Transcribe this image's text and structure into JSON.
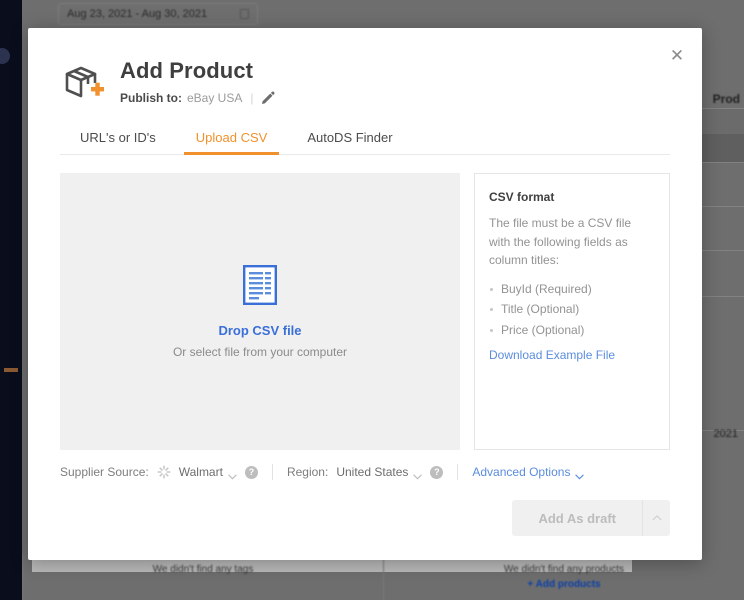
{
  "background": {
    "date_range": "Aug 23, 2021 - Aug 30, 2021",
    "right_panel_title": "Prod",
    "right_value_1": "",
    "right_value_2": "",
    "year_label": "2021",
    "footer_cells": [
      {
        "text": "We didn't find any tags",
        "link": ""
      },
      {
        "text": "We didn't find any products",
        "link": "+ Add products"
      }
    ]
  },
  "modal": {
    "close_label": "✕",
    "title": "Add Product",
    "publish_label": "Publish to:",
    "publish_value": "eBay USA",
    "separator": "|",
    "tabs": [
      {
        "label": "URL's or ID's",
        "active": false
      },
      {
        "label": "Upload CSV",
        "active": true
      },
      {
        "label": "AutoDS Finder",
        "active": false
      }
    ],
    "dropzone": {
      "title": "Drop CSV file",
      "subtitle": "Or select file from your computer"
    },
    "csv_format": {
      "heading": "CSV format",
      "description": "The file must be a CSV file with the following fields as column titles:",
      "fields": [
        "BuyId (Required)",
        "Title (Optional)",
        "Price (Optional)"
      ],
      "download_link": "Download Example File"
    },
    "footer": {
      "supplier_label": "Supplier Source:",
      "supplier_value": "Walmart",
      "region_label": "Region:",
      "region_value": "United States",
      "advanced_options": "Advanced Options",
      "help_glyph": "?"
    },
    "actions": {
      "submit_label": "Add As draft"
    }
  },
  "colors": {
    "accent_orange": "#f0912d",
    "link_blue": "#5b8ddd",
    "drop_blue": "#3a6fd8",
    "backdrop": "#6e6e6e",
    "sidebar_dark": "#0a0e1c"
  }
}
